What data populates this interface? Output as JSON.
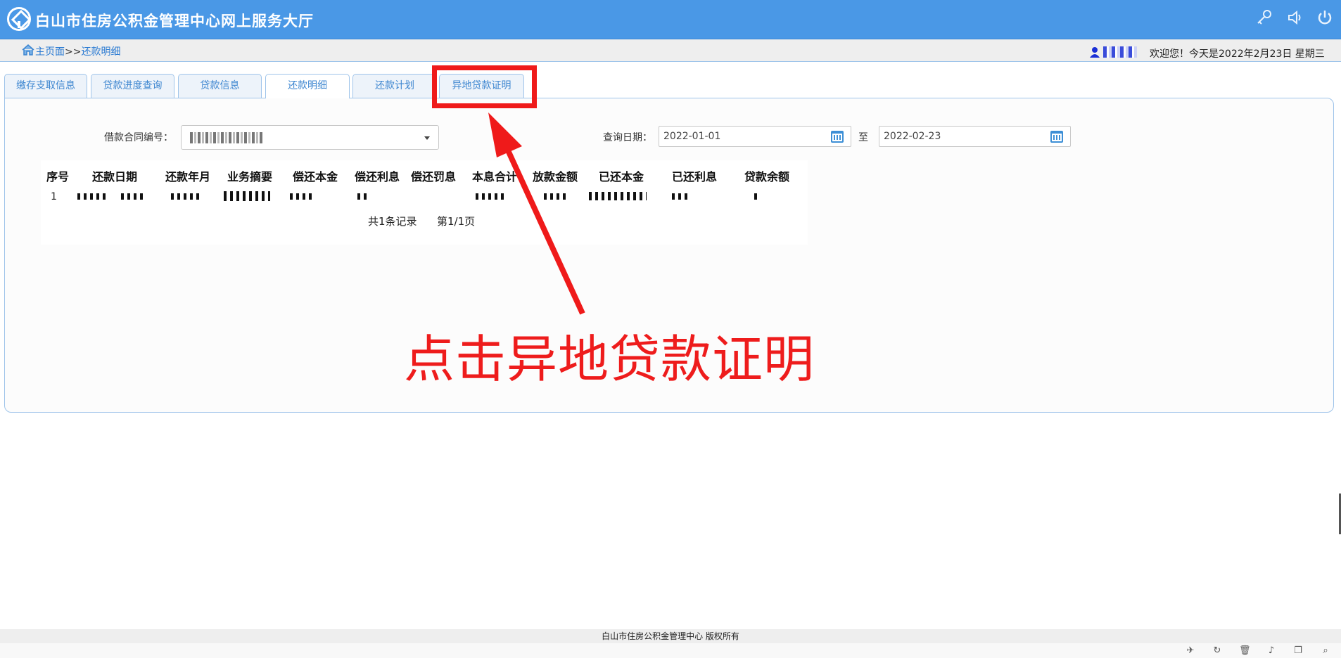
{
  "header": {
    "title": "白山市住房公积金管理中心网上服务大厅",
    "icons": [
      "key-icon",
      "speaker-icon",
      "power-icon"
    ]
  },
  "breadcrumb": {
    "home": "主页面",
    "separator": ">>",
    "current": "还款明细"
  },
  "user": {
    "welcome": "欢迎您！今天是2022年2月23日 星期三"
  },
  "tabs": [
    {
      "label": "缴存支取信息",
      "active": false
    },
    {
      "label": "贷款进度查询",
      "active": false
    },
    {
      "label": "贷款信息",
      "active": false
    },
    {
      "label": "还款明细",
      "active": true
    },
    {
      "label": "还款计划",
      "active": false
    },
    {
      "label": "异地贷款证明",
      "active": false
    }
  ],
  "filters": {
    "contract_label": "借款合同编号：",
    "date_label": "查询日期：",
    "date_from": "2022-01-01",
    "date_sep": "至",
    "date_to": "2022-02-23"
  },
  "table": {
    "columns": [
      "序号",
      "还款日期",
      "还款年月",
      "业务摘要",
      "偿还本金",
      "偿还利息",
      "偿还罚息",
      "本息合计",
      "放款金额",
      "已还本金",
      "已还利息",
      "贷款余额"
    ],
    "rows": [
      {
        "index": "1"
      }
    ],
    "pager": {
      "total": "共1条记录",
      "page": "第1/1页"
    }
  },
  "annotation": {
    "text": "点击异地贷款证明",
    "color": "#ee1c1c"
  },
  "footer": {
    "copyright": "白山市住房公积金管理中心 版权所有"
  },
  "colors": {
    "header_bg": "#4a98e6",
    "tab_text": "#3d86d0",
    "border": "#9fc4ea"
  }
}
